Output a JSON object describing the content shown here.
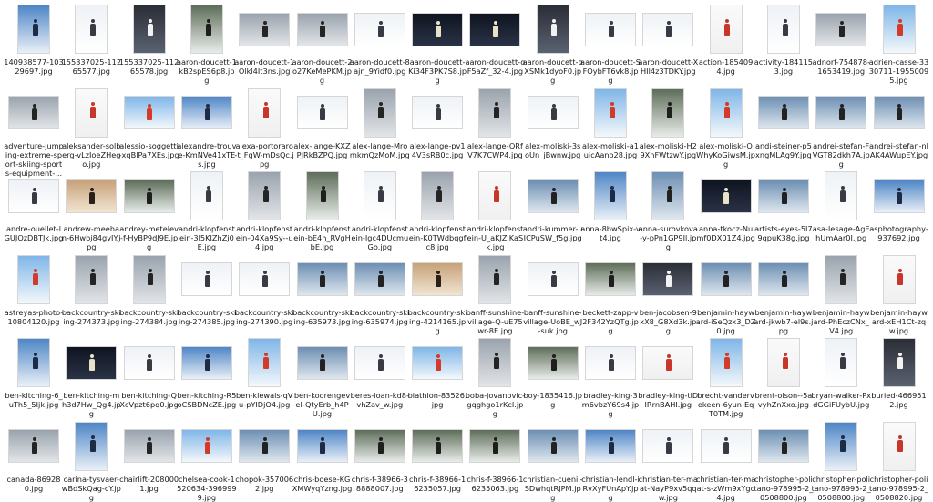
{
  "palettes": {
    "snow": {
      "top": "#eef2f6",
      "bottom": "#ffffff",
      "fig": "#3a3a44"
    },
    "blue": {
      "top": "#4f86c6",
      "bottom": "#e9f0f8",
      "fig": "#1d2b44"
    },
    "sky": {
      "top": "#7fb6e8",
      "bottom": "#f4f8fb",
      "fig": "#d43a2a"
    },
    "dark": {
      "top": "#2b2e36",
      "bottom": "#5a6170",
      "fig": "#f2f2f2"
    },
    "night": {
      "top": "#0f1420",
      "bottom": "#2a3246",
      "fig": "#e8e2c8"
    },
    "mountain": {
      "top": "#6d8fb3",
      "bottom": "#dfe7ee",
      "fig": "#222222"
    },
    "grey": {
      "top": "#9aa3ad",
      "bottom": "#e2e5e8",
      "fig": "#242424"
    },
    "forest": {
      "top": "#5e6e5a",
      "bottom": "#e8ece9",
      "fig": "#1e1e1e"
    },
    "sunset": {
      "top": "#c7a27a",
      "bottom": "#f1e5d2",
      "fig": "#2a2018"
    },
    "white": {
      "top": "#fafafa",
      "bottom": "#f0f0f0",
      "fig": "#c8362a"
    }
  },
  "files": [
    {
      "name": "140938577-10329697.jpg",
      "shape": "portrait",
      "palette": "blue"
    },
    {
      "name": "155337025-11265577.jpg",
      "shape": "portrait",
      "palette": "snow"
    },
    {
      "name": "155337025-11265578.jpg",
      "shape": "portrait",
      "palette": "dark"
    },
    {
      "name": "aaron-doucett-1kB2spES6p8.jpg",
      "shape": "portrait",
      "palette": "forest"
    },
    {
      "name": "aaron-doucett-1Olkl4It3ns.jpg",
      "shape": "landscape",
      "palette": "grey"
    },
    {
      "name": "aaron-doucett-2o27KeMePKM.jpg",
      "shape": "landscape",
      "palette": "grey"
    },
    {
      "name": "aaron-doucett-8ajn_9Yidf0.jpg",
      "shape": "landscape",
      "palette": "snow"
    },
    {
      "name": "aaron-doucett-Ki34F3PK7S8.jpg",
      "shape": "landscape",
      "palette": "night"
    },
    {
      "name": "aaron-doucett-oF5aZf_32-4.jpg",
      "shape": "landscape",
      "palette": "night"
    },
    {
      "name": "aaron-doucett-oXSMk1dyoF0.jpg",
      "shape": "portrait",
      "palette": "dark"
    },
    {
      "name": "aaron-doucett-SFOybFT6vk8.jpg",
      "shape": "landscape",
      "palette": "snow"
    },
    {
      "name": "aaron-doucett-XHIl4z3TDKY.jpg",
      "shape": "landscape",
      "palette": "snow"
    },
    {
      "name": "action-1854094.jpg",
      "shape": "portrait",
      "palette": "white"
    },
    {
      "name": "activity-1841153.jpg",
      "shape": "portrait",
      "palette": "snow"
    },
    {
      "name": "adnorf-754878-1653419.jpg",
      "shape": "landscape",
      "palette": "grey"
    },
    {
      "name": "adrien-casse-3330711-19550095.jpg",
      "shape": "portrait",
      "palette": "sky"
    },
    {
      "name": "adventure-jumping-extreme-sport-skiing-sports-equipment-...",
      "shape": "landscape",
      "palette": "grey"
    },
    {
      "name": "aleksander-solberg-vLzIoeZHego.jpg",
      "shape": "portrait",
      "palette": "white"
    },
    {
      "name": "alessio-soggetti-xqBlPa7XEs.jpg",
      "shape": "landscape",
      "palette": "sky"
    },
    {
      "name": "alexandre-trouve-KmNVe41xTEs.jpg",
      "shape": "landscape",
      "palette": "blue"
    },
    {
      "name": "alexa-portoraro-t_FgW-mDsQc.jpg",
      "shape": "portrait",
      "palette": "white"
    },
    {
      "name": "alex-lange-KXZPJRkBZPQ.jpg",
      "shape": "landscape",
      "palette": "snow"
    },
    {
      "name": "alex-lange-MromkmQzMoM.jpg",
      "shape": "portrait",
      "palette": "grey"
    },
    {
      "name": "alex-lange-pv14V3sRB0c.jpg",
      "shape": "landscape",
      "palette": "snow"
    },
    {
      "name": "alex-lange-QRfV7K7CWP4.jpg",
      "shape": "portrait",
      "palette": "grey"
    },
    {
      "name": "alex-moliski-3soUn_jBwnw.jpg",
      "shape": "landscape",
      "palette": "snow"
    },
    {
      "name": "alex-moliski-a1uicAano28.jpg",
      "shape": "portrait",
      "palette": "sky"
    },
    {
      "name": "alex-moliski-H29XnFWtzwY.jpg",
      "shape": "portrait",
      "palette": "forest"
    },
    {
      "name": "alex-moliski-OWhyKoGiwsM.jpg",
      "shape": "portrait",
      "palette": "sky"
    },
    {
      "name": "andi-steiner-p5xngMLAg9Y.jpg",
      "shape": "landscape",
      "palette": "mountain"
    },
    {
      "name": "andrei-stefan-FVGT82dkh7A.jpg",
      "shape": "landscape",
      "palette": "mountain"
    },
    {
      "name": "andrei-stefan-nlAK4AWupEY.jpg",
      "shape": "landscape",
      "palette": "mountain"
    },
    {
      "name": "andre-ouellet-lGUJOzDBTJk.jpg",
      "shape": "landscape",
      "palette": "snow"
    },
    {
      "name": "andrew-meehan-6Hwbj84gyIY.jpg",
      "shape": "landscape",
      "palette": "sunset"
    },
    {
      "name": "andrey-metelev-f-HyBP9dJ9E.jpg",
      "shape": "landscape",
      "palette": "forest"
    },
    {
      "name": "andri-klopfenstein-3l5KIZhZj0E.jpg",
      "shape": "portrait",
      "palette": "snow"
    },
    {
      "name": "andri-klopfenstein-04Xa9Sy--u4.jpg",
      "shape": "portrait",
      "palette": "grey"
    },
    {
      "name": "andri-klopfenstein-bE4h_RVgHbE.jpg",
      "shape": "portrait",
      "palette": "forest"
    },
    {
      "name": "andri-klopfenstein-Igc4DUcmuGo.jpg",
      "shape": "portrait",
      "palette": "snow"
    },
    {
      "name": "andri-klopfenstein-K0TWdbqgfc8.jpg",
      "shape": "portrait",
      "palette": "grey"
    },
    {
      "name": "andri-klopfenstein-U_aKJZiKaSk.jpg",
      "shape": "portrait",
      "palette": "white"
    },
    {
      "name": "andri-kummer-uICPuSW_f5g.jpg",
      "shape": "landscape",
      "palette": "mountain"
    },
    {
      "name": "anna-8bwSpix-vt4.jpg",
      "shape": "portrait",
      "palette": "blue"
    },
    {
      "name": "anna-surovkova-y-pPn1GP9Il.jpg",
      "shape": "portrait",
      "palette": "mountain"
    },
    {
      "name": "anna-tkocz-Numf0DX01Z4.jpg",
      "shape": "landscape",
      "palette": "night"
    },
    {
      "name": "artists-eyes-5I79qpuK38g.jpg",
      "shape": "landscape",
      "palette": "mountain"
    },
    {
      "name": "asa-lesage-AgEhUmAar0I.jpg",
      "shape": "portrait",
      "palette": "snow"
    },
    {
      "name": "asphotography-937692.jpg",
      "shape": "landscape",
      "palette": "blue"
    },
    {
      "name": "astreyas-photo-10804120.jpg",
      "shape": "portrait",
      "palette": "sky"
    },
    {
      "name": "backcountry-skiing-274373.jpg",
      "shape": "portrait",
      "palette": "grey"
    },
    {
      "name": "backcountry-skiing-274384.jpg",
      "shape": "portrait",
      "palette": "grey"
    },
    {
      "name": "backcountry-skiing-274385.jpg",
      "shape": "landscape",
      "palette": "snow"
    },
    {
      "name": "backcountry-skiing-274390.jpg",
      "shape": "landscape",
      "palette": "snow"
    },
    {
      "name": "backcountry-skiing-635973.jpg",
      "shape": "landscape",
      "palette": "mountain"
    },
    {
      "name": "backcountry-skiing-635974.jpg",
      "shape": "landscape",
      "palette": "mountain"
    },
    {
      "name": "backcountry-skiing-4214165.jpg",
      "shape": "landscape",
      "palette": "sunset"
    },
    {
      "name": "banff-sunshine-village-Q-uE75wr-8E.jpg",
      "shape": "portrait",
      "palette": "grey"
    },
    {
      "name": "banff-sunshine-village-UoBE_wJ-suk.jpg",
      "shape": "landscape",
      "palette": "snow"
    },
    {
      "name": "beckett-zapp-v2F342YzQTg.jpg",
      "shape": "landscape",
      "palette": "forest"
    },
    {
      "name": "ben-jacobsen-9xX8_G8Xd3k.jpg",
      "shape": "landscape",
      "palette": "dark"
    },
    {
      "name": "benjamin-hayward-iSeQzx3_DZ0.jpg",
      "shape": "landscape",
      "palette": "mountain"
    },
    {
      "name": "benjamin-hayward-jkwb7-el9s.jpg",
      "shape": "landscape",
      "palette": "mountain"
    },
    {
      "name": "benjamin-hayward-PhEczCNx_V4.jpg",
      "shape": "portrait",
      "palette": "grey"
    },
    {
      "name": "benjamin-hayward-xEH1Ct-zqw.jpg",
      "shape": "portrait",
      "palette": "white"
    },
    {
      "name": "ben-kitching-6_uTh5_5Ijk.jpg",
      "shape": "portrait",
      "palette": "blue"
    },
    {
      "name": "ben-kitching-mh3d7Hw_Qg4.jpg",
      "shape": "landscape",
      "palette": "night"
    },
    {
      "name": "ben-kitching-QXcVpzt6pq0.jpg",
      "shape": "landscape",
      "palette": "snow"
    },
    {
      "name": "ben-kitching-R5oCSBDNcZE.jpg",
      "shape": "landscape",
      "palette": "blue"
    },
    {
      "name": "ben-klewais-qVu-pYIDjO4.jpg",
      "shape": "portrait",
      "palette": "sky"
    },
    {
      "name": "ben-koorengevel-QtyErb_h4PU.jpg",
      "shape": "landscape",
      "palette": "mountain"
    },
    {
      "name": "beres-ioan-kd8-vhZav_w.jpg",
      "shape": "landscape",
      "palette": "snow"
    },
    {
      "name": "biathlon-83526.jpg",
      "shape": "landscape",
      "palette": "sky"
    },
    {
      "name": "boba-jovanovic-gqghgo1rKcI.jpg",
      "shape": "portrait",
      "palette": "grey"
    },
    {
      "name": "boy-1835416.jpg",
      "shape": "landscape",
      "palette": "forest"
    },
    {
      "name": "bradley-king-3m6vbzY69s4.jpg",
      "shape": "landscape",
      "palette": "snow"
    },
    {
      "name": "bradley-king-tlDIRrnBAHI.jpg",
      "shape": "landscape",
      "palette": "white"
    },
    {
      "name": "brecht-vandervekeen-6yun-EqT0TM.jpg",
      "shape": "portrait",
      "palette": "sky"
    },
    {
      "name": "brent-olson--5avyhZnXxo.jpg",
      "shape": "portrait",
      "palette": "white"
    },
    {
      "name": "bryan-walker-PxdGGiFUybU.jpg",
      "shape": "portrait",
      "palette": "snow"
    },
    {
      "name": "buried-4669512.jpg",
      "shape": "portrait",
      "palette": "dark"
    },
    {
      "name": "canada-869280.jpg",
      "shape": "landscape",
      "palette": "grey"
    },
    {
      "name": "carina-tysvaer-wBdSkQag-cY.jpg",
      "shape": "portrait",
      "palette": "blue"
    },
    {
      "name": "chairlift-2080001.jpg",
      "shape": "landscape",
      "palette": "grey"
    },
    {
      "name": "chelsea-cook-1520634-3969999.jpg",
      "shape": "landscape",
      "palette": "sky"
    },
    {
      "name": "chopok-3570062.jpg",
      "shape": "landscape",
      "palette": "mountain"
    },
    {
      "name": "chris-boese-KGXMWyqYzng.jpg",
      "shape": "landscape",
      "palette": "blue"
    },
    {
      "name": "chris-f-38966-38888007.jpg",
      "shape": "landscape",
      "palette": "forest"
    },
    {
      "name": "chris-f-38966-16235057.jpg",
      "shape": "landscape",
      "palette": "forest"
    },
    {
      "name": "chris-f-38966-16235063.jpg",
      "shape": "landscape",
      "palette": "forest"
    },
    {
      "name": "christian-cuenii-SDwhqtRJPM.jpg",
      "shape": "landscape",
      "palette": "mountain"
    },
    {
      "name": "christian-lendl-iRvXyFUnApY.jpg",
      "shape": "landscape",
      "palette": "blue"
    },
    {
      "name": "christian-ter-maat-NayP9xv5qqw.jpg",
      "shape": "landscape",
      "palette": "snow"
    },
    {
      "name": "christian-ter-maat-s-zWm9xYgo4.jpg",
      "shape": "landscape",
      "palette": "snow"
    },
    {
      "name": "christopher-politano-978995-2_0508800.jpg",
      "shape": "landscape",
      "palette": "mountain"
    },
    {
      "name": "christopher-politano-978995-2_0508800.jpg",
      "shape": "portrait",
      "palette": "blue"
    },
    {
      "name": "christopher-politano-978995-2_0508820.jpg",
      "shape": "portrait",
      "palette": "white"
    }
  ]
}
